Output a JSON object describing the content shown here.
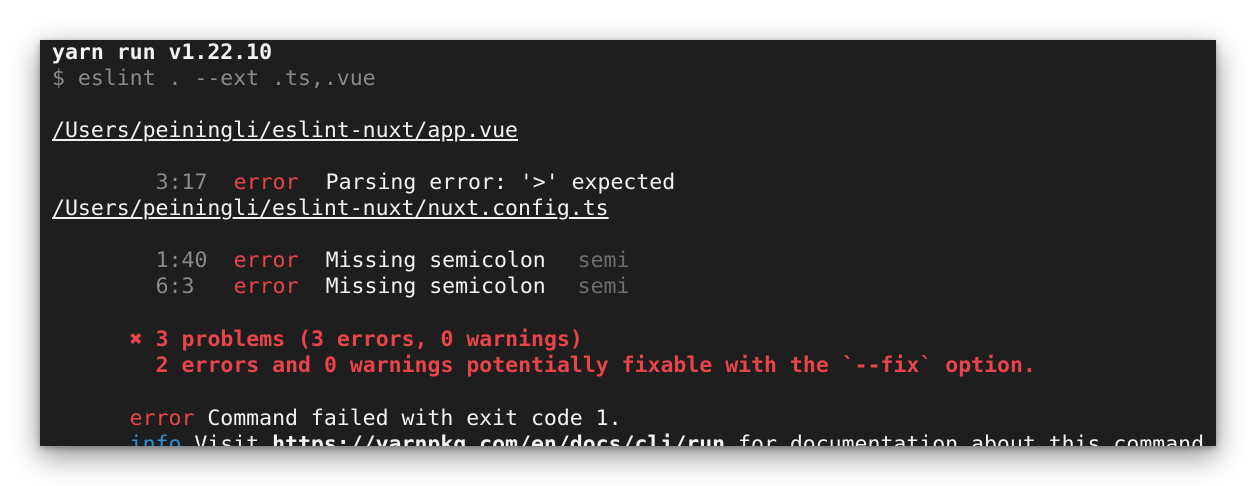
{
  "header": {
    "title": "yarn run v1.22.10",
    "command": "$ eslint . --ext .ts,.vue"
  },
  "files": [
    {
      "path": "/Users/peiningli/eslint-nuxt/app.vue",
      "problems": [
        {
          "position": "3:17",
          "severity": "error",
          "message": "Parsing error: '>' expected",
          "rule": ""
        }
      ]
    },
    {
      "path": "/Users/peiningli/eslint-nuxt/nuxt.config.ts",
      "problems": [
        {
          "position": "1:40",
          "severity": "error",
          "message": "Missing semicolon",
          "rule": "semi"
        },
        {
          "position": "6:3",
          "severity": "error",
          "message": "Missing semicolon",
          "rule": "semi"
        }
      ]
    }
  ],
  "summary": {
    "icon": "cross-icon",
    "icon_glyph": "✖",
    "problems_line": "3 problems (3 errors, 0 warnings)",
    "fixable_line": "2 errors and 0 warnings potentially fixable with the `--fix` option."
  },
  "footer": {
    "error_prefix": "error",
    "error_text": " Command failed with exit code 1.",
    "info_prefix": "info",
    "info_visit": " Visit ",
    "info_url": "https://yarnpkg.com/en/docs/cli/run",
    "info_suffix": " for documentation about this command."
  },
  "colors": {
    "background": "#1e1e1e",
    "error": "#e8444a",
    "info": "#2f8fd8",
    "muted": "#8a8a8a"
  }
}
